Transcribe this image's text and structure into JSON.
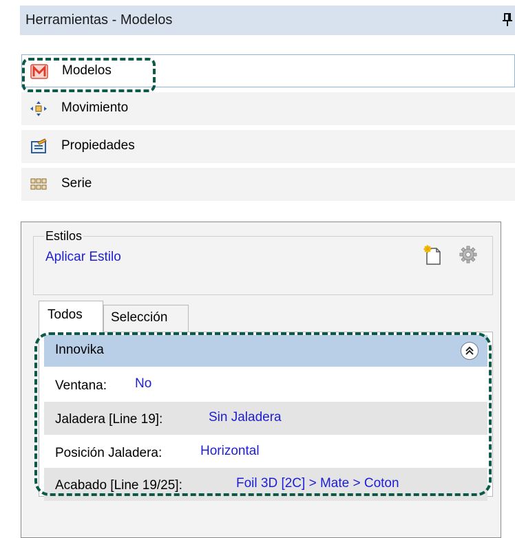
{
  "panel": {
    "title": "Herramientas - Modelos",
    "pin_icon": "pin-icon"
  },
  "nav": {
    "items": [
      {
        "label": "Modelos",
        "icon": "modelos-icon",
        "selected": true
      },
      {
        "label": "Movimiento",
        "icon": "move-icon",
        "selected": false
      },
      {
        "label": "Propiedades",
        "icon": "properties-icon",
        "selected": false
      },
      {
        "label": "Serie",
        "icon": "series-icon",
        "selected": false
      }
    ]
  },
  "styles": {
    "legend": "Estilos",
    "apply_link": "Aplicar Estilo",
    "icons": [
      "new-style-icon",
      "gear-icon"
    ]
  },
  "tabs": [
    {
      "label": "Todos",
      "active": true
    },
    {
      "label": "Selección",
      "active": false
    }
  ],
  "group": {
    "title": "Innovika",
    "rows": [
      {
        "label": "Ventana:",
        "value": "No"
      },
      {
        "label": "Jaladera [Line 19]:",
        "value": "Sin Jaladera"
      },
      {
        "label": "Posición Jaladera:",
        "value": "Horizontal"
      },
      {
        "label": "Acabado [Line 19/25]:",
        "value": "Foil 3D [2C] > Mate > Coton"
      }
    ]
  },
  "colors": {
    "header_bg": "#d8e2ef",
    "group_header_bg": "#b9cfe7",
    "link": "#1d1dd6",
    "highlight": "#0b5a48"
  }
}
